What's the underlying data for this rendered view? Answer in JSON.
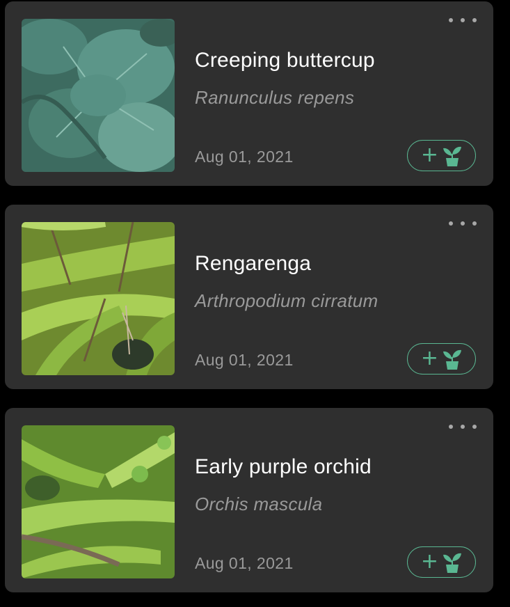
{
  "plants": [
    {
      "name": "Creeping buttercup",
      "scientific_name": "Ranunculus repens",
      "date": "Aug 01, 2021",
      "image_icon": "leafy-plant-photo",
      "more_icon": "more-dots-icon",
      "add_icon": "add-to-garden-icon"
    },
    {
      "name": "Rengarenga",
      "scientific_name": "Arthropodium cirratum",
      "date": "Aug 01, 2021",
      "image_icon": "grass-plant-photo",
      "more_icon": "more-dots-icon",
      "add_icon": "add-to-garden-icon"
    },
    {
      "name": "Early purple orchid",
      "scientific_name": "Orchis mascula",
      "date": "Aug 01, 2021",
      "image_icon": "orchid-leaves-photo",
      "more_icon": "more-dots-icon",
      "add_icon": "add-to-garden-icon"
    }
  ],
  "colors": {
    "background": "#000000",
    "card": "#2f2f2f",
    "title": "#ffffff",
    "muted": "#9a9a9a",
    "accent": "#5ab792"
  }
}
